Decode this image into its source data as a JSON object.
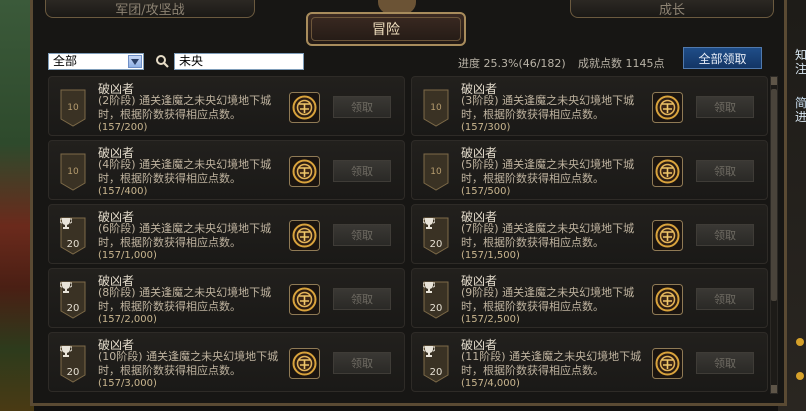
{
  "tabs": {
    "left": "军团/攻坚战",
    "right": "成长",
    "active": "冒险"
  },
  "filter": {
    "category_value": "全部",
    "search_value": "未央"
  },
  "summary": {
    "progress": "进度 25.3%(46/182)",
    "points": "成就点数 1145点",
    "claim_all": "全部领取"
  },
  "side_text": [
    "知",
    "注",
    "简",
    "进"
  ],
  "cards": [
    {
      "badge": "10",
      "badge_type": "shield",
      "title": "破凶者",
      "stage": "(2阶段)",
      "desc": "通关逢魔之未央幻境地下城时，根据阶数获得相应点数。",
      "progress": "(157/200)",
      "button": "领取"
    },
    {
      "badge": "10",
      "badge_type": "shield",
      "title": "破凶者",
      "stage": "(3阶段)",
      "desc": "通关逢魔之未央幻境地下城时，根据阶数获得相应点数。",
      "progress": "(157/300)",
      "button": "领取"
    },
    {
      "badge": "10",
      "badge_type": "shield",
      "title": "破凶者",
      "stage": "(4阶段)",
      "desc": "通关逢魔之未央幻境地下城时，根据阶数获得相应点数。",
      "progress": "(157/400)",
      "button": "领取"
    },
    {
      "badge": "10",
      "badge_type": "shield",
      "title": "破凶者",
      "stage": "(5阶段)",
      "desc": "通关逢魔之未央幻境地下城时，根据阶数获得相应点数。",
      "progress": "(157/500)",
      "button": "领取"
    },
    {
      "badge": "20",
      "badge_type": "trophy",
      "title": "破凶者",
      "stage": "(6阶段)",
      "desc": "通关逢魔之未央幻境地下城时，根据阶数获得相应点数。",
      "progress": "(157/1,000)",
      "button": "领取"
    },
    {
      "badge": "20",
      "badge_type": "trophy",
      "title": "破凶者",
      "stage": "(7阶段)",
      "desc": "通关逢魔之未央幻境地下城时，根据阶数获得相应点数。",
      "progress": "(157/1,500)",
      "button": "领取"
    },
    {
      "badge": "20",
      "badge_type": "trophy",
      "title": "破凶者",
      "stage": "(8阶段)",
      "desc": "通关逢魔之未央幻境地下城时，根据阶数获得相应点数。",
      "progress": "(157/2,000)",
      "button": "领取"
    },
    {
      "badge": "20",
      "badge_type": "trophy",
      "title": "破凶者",
      "stage": "(9阶段)",
      "desc": "通关逢魔之未央幻境地下城时，根据阶数获得相应点数。",
      "progress": "(157/2,500)",
      "button": "领取"
    },
    {
      "badge": "20",
      "badge_type": "trophy",
      "title": "破凶者",
      "stage": "(10阶段)",
      "desc": "通关逢魔之未央幻境地下城时，根据阶数获得相应点数。",
      "progress": "(157/3,000)",
      "button": "领取"
    },
    {
      "badge": "20",
      "badge_type": "trophy",
      "title": "破凶者",
      "stage": "(11阶段)",
      "desc": "通关逢魔之未央幻境地下城时，根据阶数获得相应点数。",
      "progress": "(157/4,000)",
      "button": "领取"
    }
  ],
  "colors": {
    "claim_all_bg": "#1f4d88",
    "frame_border": "#5a4a33",
    "text_gold": "#c9b68f"
  }
}
